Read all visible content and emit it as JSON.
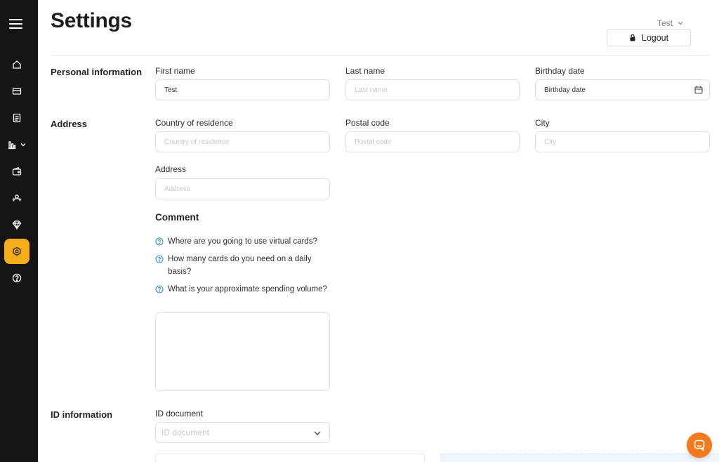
{
  "header": {
    "title": "Settings",
    "user_name": "Test",
    "logout_label": "Logout"
  },
  "sidebar": {
    "items": [
      {
        "icon": "home-icon"
      },
      {
        "icon": "card-icon"
      },
      {
        "icon": "document-icon"
      },
      {
        "icon": "bar-chart-icon"
      },
      {
        "icon": "wallet-icon"
      },
      {
        "icon": "team-icon"
      },
      {
        "icon": "diamond-icon"
      },
      {
        "icon": "settings-icon",
        "active": true
      },
      {
        "icon": "help-icon"
      }
    ],
    "active_color": "#f6ad1b"
  },
  "sections": {
    "personal": "Personal information",
    "address": "Address",
    "id": "ID information"
  },
  "fields": {
    "first_name": {
      "label": "First name",
      "value": "Test"
    },
    "last_name": {
      "label": "Last name",
      "placeholder": "Last name"
    },
    "birthday": {
      "label": "Birthday date",
      "placeholder": "Birthday date"
    },
    "country": {
      "label": "Country of residence",
      "placeholder": "Country of residence"
    },
    "postal": {
      "label": "Postal code",
      "placeholder": "Postal code"
    },
    "city": {
      "label": "City",
      "placeholder": "City"
    },
    "address": {
      "label": "Address",
      "placeholder": "Address"
    },
    "id_document": {
      "label": "ID document",
      "placeholder": "ID document"
    }
  },
  "comment": {
    "title": "Comment",
    "questions": [
      "Where are you going to use virtual cards?",
      "How many cards do you need on a daily basis?",
      "What is your approximate spending volume?"
    ]
  },
  "colors": {
    "accent": "#f6ad1b",
    "chat": "#f47a1e",
    "question_icon": "#3b8fd6"
  }
}
